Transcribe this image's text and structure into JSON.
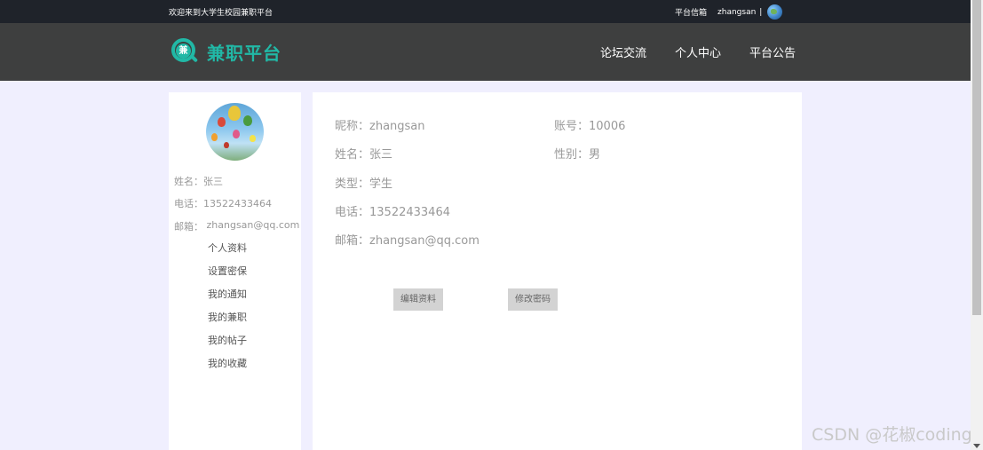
{
  "topbar": {
    "welcome": "欢迎来到大学生校园兼职平台",
    "mailbox": "平台信箱",
    "username": "zhangsan",
    "separator": "|"
  },
  "header": {
    "logo_char": "兼",
    "logo_text": "兼职平台",
    "nav": [
      "论坛交流",
      "个人中心",
      "平台公告"
    ]
  },
  "sidebar": {
    "name": "姓名：张三",
    "phone": "电话：13522433464",
    "email_label": "邮箱：",
    "email_value": "zhangsan@qq.com",
    "menu": [
      "个人资料",
      "设置密保",
      "我的通知",
      "我的兼职",
      "我的帖子",
      "我的收藏"
    ]
  },
  "profile": {
    "nickname": "昵称：zhangsan",
    "account": "账号：10006",
    "name": "姓名：张三",
    "gender": "性别：男",
    "type": "类型：学生",
    "phone": "电话：13522433464",
    "email": "邮箱：zhangsan@qq.com"
  },
  "buttons": {
    "edit": "编辑资料",
    "change_password": "修改密码"
  },
  "watermark": "CSDN @花椒coding",
  "colors": {
    "accent": "#21b8a6",
    "topbar_bg": "#1f232a",
    "header_bg": "#3e3f3f",
    "page_bg": "#f0effe"
  }
}
